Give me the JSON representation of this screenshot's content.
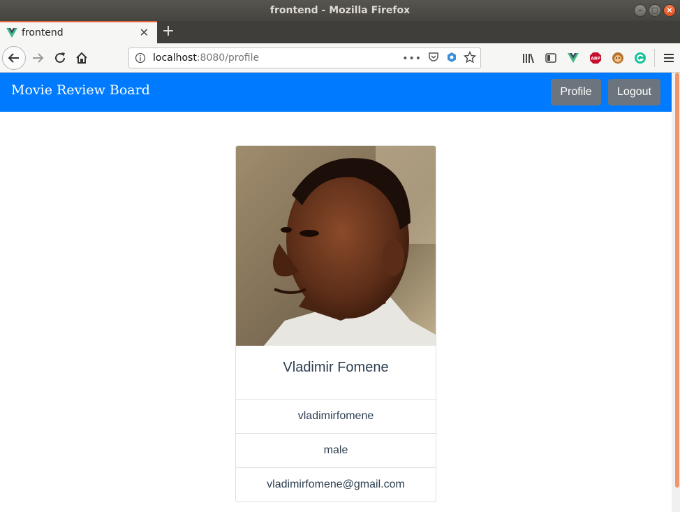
{
  "window": {
    "title": "frontend - Mozilla Firefox"
  },
  "browser": {
    "tab": {
      "label": "frontend"
    },
    "url": {
      "host": "localhost",
      "rest": ":8080/profile"
    },
    "extensions": {
      "abp_label": "ABP"
    }
  },
  "app": {
    "brand": "Movie Review Board",
    "nav": {
      "profile_label": "Profile",
      "logout_label": "Logout"
    },
    "colors": {
      "header": "#007bff",
      "button": "#6c757d"
    }
  },
  "profile": {
    "name": "Vladimir Fomene",
    "username": "vladimirfomene",
    "gender": "male",
    "email": "vladimirfomene@gmail.com"
  }
}
